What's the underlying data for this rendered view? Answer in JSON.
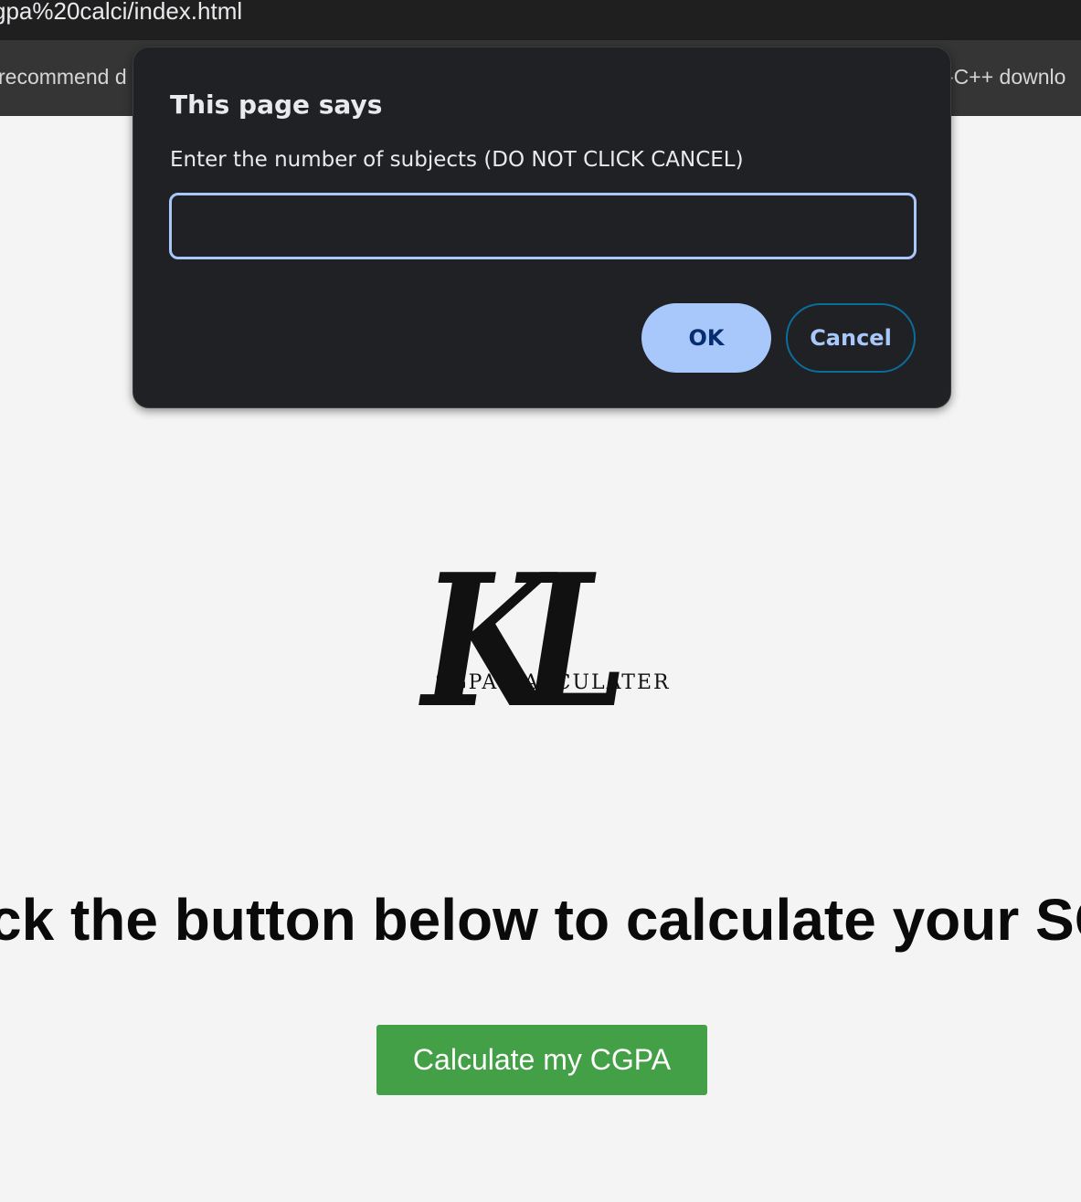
{
  "browser": {
    "url_fragment": "gpa%20calci/index.html",
    "bookmarks": {
      "left_label": "recommend d",
      "right_label": "-C++ downlo"
    }
  },
  "page": {
    "logo": {
      "mark": "KL",
      "subtitle": "SGPA CALCULATER"
    },
    "heading": "ck the button below to calculate your SG",
    "calculate_button": "Calculate my CGPA"
  },
  "dialog": {
    "title": "This page says",
    "message": "Enter the number of subjects (DO NOT CLICK CANCEL)",
    "input_value": "",
    "ok_label": "OK",
    "cancel_label": "Cancel"
  },
  "colors": {
    "dialog_bg": "#202124",
    "ok_button": "#a8c7fa",
    "calculate_button": "#43a047",
    "page_bg": "#f4f4f4"
  }
}
